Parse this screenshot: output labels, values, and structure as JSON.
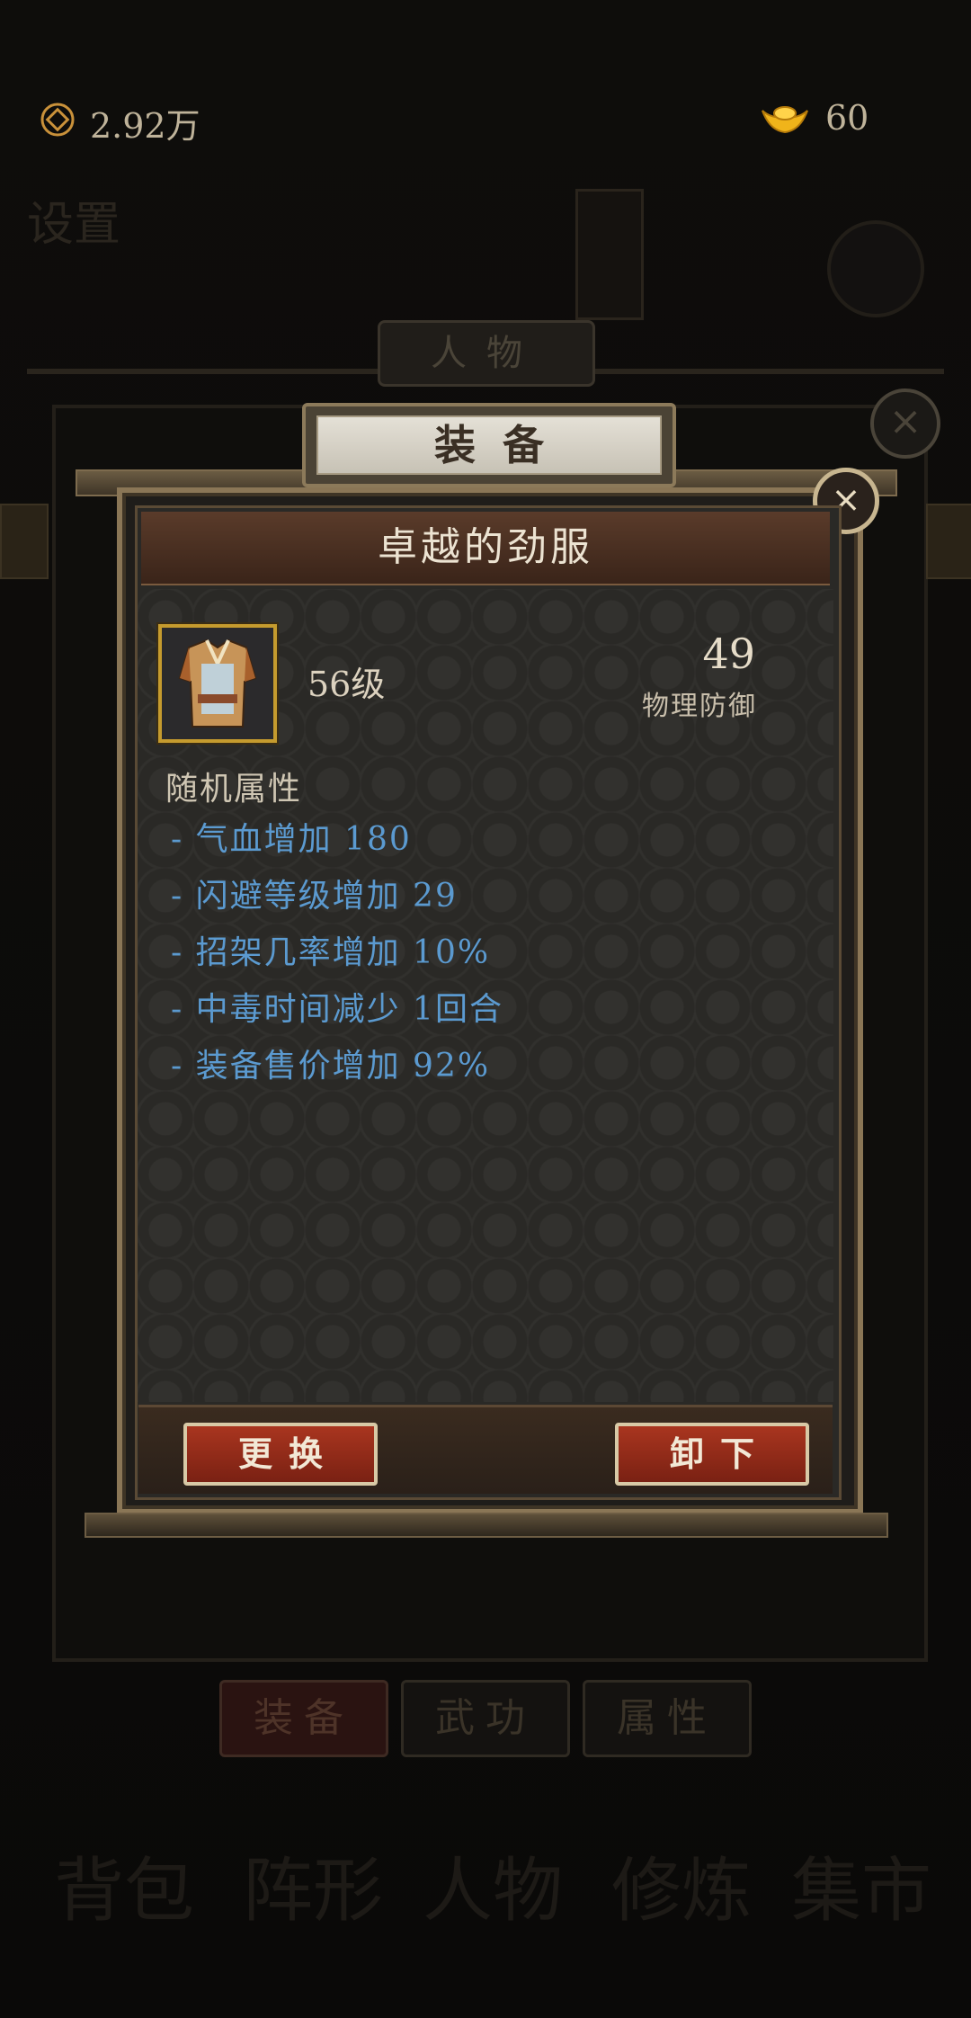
{
  "topbar": {
    "coin_value": "2.92万",
    "ingot_value": "60",
    "coin_icon": "copper-coin-icon",
    "ingot_icon": "gold-ingot-icon"
  },
  "background": {
    "settings_label": "设置",
    "people_tab_label": "人物",
    "tabs": [
      "装备",
      "武功",
      "属性"
    ],
    "bottom_nav": [
      "背包",
      "阵形",
      "人物",
      "修炼",
      "集市"
    ]
  },
  "dialog": {
    "tab_title": "装备",
    "item_name": "卓越的劲服",
    "item_level": "56级",
    "stat_value": "49",
    "stat_label": "物理防御",
    "attributes_title": "随机属性",
    "attributes": [
      "- 气血增加 180",
      "- 闪避等级增加 29",
      "- 招架几率增加 10%",
      "- 中毒时间减少 1回合",
      "- 装备售价增加 92%"
    ],
    "replace_button": "更换",
    "unequip_button": "卸下"
  },
  "colors": {
    "attribute_blue": "#5b9ad0",
    "button_red": "#a9351f",
    "frame_gold": "#8a7656",
    "icon_border_gold": "#c59b2e"
  }
}
